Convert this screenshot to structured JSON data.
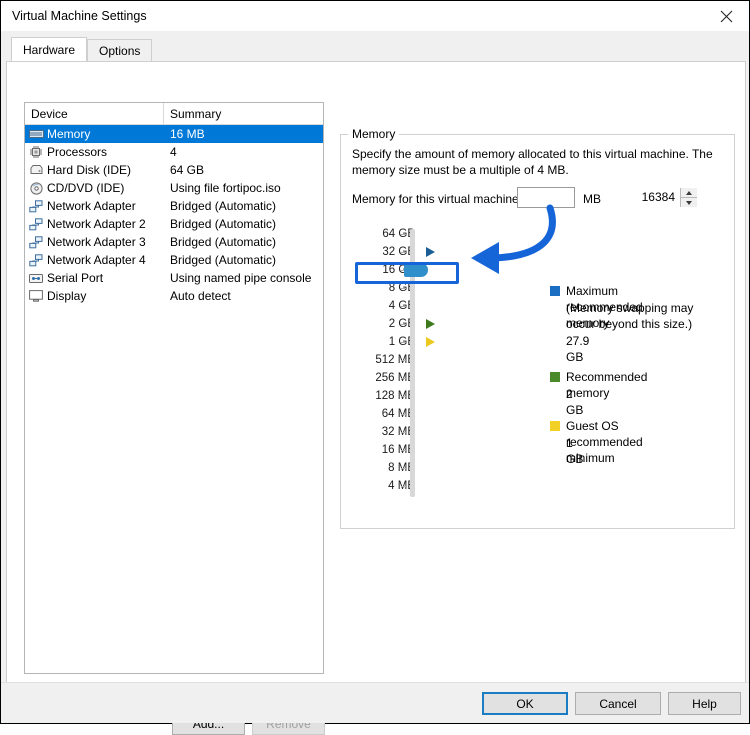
{
  "window": {
    "title": "Virtual Machine Settings",
    "close_icon": "close-icon"
  },
  "tabs": [
    {
      "label": "Hardware",
      "active": true
    },
    {
      "label": "Options",
      "active": false
    }
  ],
  "device_list": {
    "columns": [
      "Device",
      "Summary"
    ],
    "rows": [
      {
        "icon": "memory-icon",
        "device": "Memory",
        "summary": "16 MB",
        "selected": true
      },
      {
        "icon": "processor-icon",
        "device": "Processors",
        "summary": "4",
        "selected": false
      },
      {
        "icon": "hard-disk-icon",
        "device": "Hard Disk (IDE)",
        "summary": "64 GB",
        "selected": false
      },
      {
        "icon": "cd-dvd-icon",
        "device": "CD/DVD (IDE)",
        "summary": "Using file fortipoc.iso",
        "selected": false
      },
      {
        "icon": "network-adapter-icon",
        "device": "Network Adapter",
        "summary": "Bridged (Automatic)",
        "selected": false
      },
      {
        "icon": "network-adapter-icon",
        "device": "Network Adapter 2",
        "summary": "Bridged (Automatic)",
        "selected": false
      },
      {
        "icon": "network-adapter-icon",
        "device": "Network Adapter 3",
        "summary": "Bridged (Automatic)",
        "selected": false
      },
      {
        "icon": "network-adapter-icon",
        "device": "Network Adapter 4",
        "summary": "Bridged (Automatic)",
        "selected": false
      },
      {
        "icon": "serial-port-icon",
        "device": "Serial Port",
        "summary": "Using named pipe console",
        "selected": false
      },
      {
        "icon": "display-icon",
        "device": "Display",
        "summary": "Auto detect",
        "selected": false
      }
    ],
    "add_label": "Add...",
    "remove_label": "Remove"
  },
  "memory_panel": {
    "group_title": "Memory",
    "description": "Specify the amount of memory allocated to this virtual machine. The memory size must be a multiple of 4 MB.",
    "field_label": "Memory for this virtual machine:",
    "value": "16384",
    "unit": "MB",
    "spinner_up_icon": "spin-up-icon",
    "spinner_down_icon": "spin-down-icon",
    "scale_labels": [
      "64 GB",
      "32 GB",
      "16 GB",
      "8 GB",
      "4 GB",
      "2 GB",
      "1 GB",
      "512 MB",
      "256 MB",
      "128 MB",
      "64 MB",
      "32 MB",
      "16 MB",
      "8 MB",
      "4 MB"
    ],
    "slider": {
      "selected_label": "16 GB",
      "selected_index": 2,
      "thumb_color": "#2f8fcb",
      "track_color": "#d8d8d8"
    },
    "markers": [
      {
        "name": "maximum-recommended-marker",
        "label": "32 GB",
        "index": 1,
        "color": "#1b5e96"
      },
      {
        "name": "recommended-marker",
        "label": "2 GB",
        "index": 5,
        "color": "#3d7a1e"
      },
      {
        "name": "guest-os-minimum-marker",
        "label": "1 GB",
        "index": 6,
        "color": "#ecc81e"
      }
    ],
    "legend": [
      {
        "name": "maximum-recommended-memory",
        "color": "#1b6ec2",
        "title": "Maximum recommended memory",
        "note": "(Memory swapping may\noccur beyond this size.)",
        "value": "27.9 GB"
      },
      {
        "name": "recommended-memory",
        "color": "#4a8a2a",
        "title": "Recommended memory",
        "note": "",
        "value": "2 GB"
      },
      {
        "name": "guest-os-recommended-minimum",
        "color": "#f2d024",
        "title": "Guest OS recommended minimum",
        "note": "",
        "value": "1 GB"
      }
    ]
  },
  "annotation": {
    "color": "#1565d8",
    "highlight_target": "16 GB"
  },
  "footer": {
    "ok_label": "OK",
    "cancel_label": "Cancel",
    "help_label": "Help"
  }
}
